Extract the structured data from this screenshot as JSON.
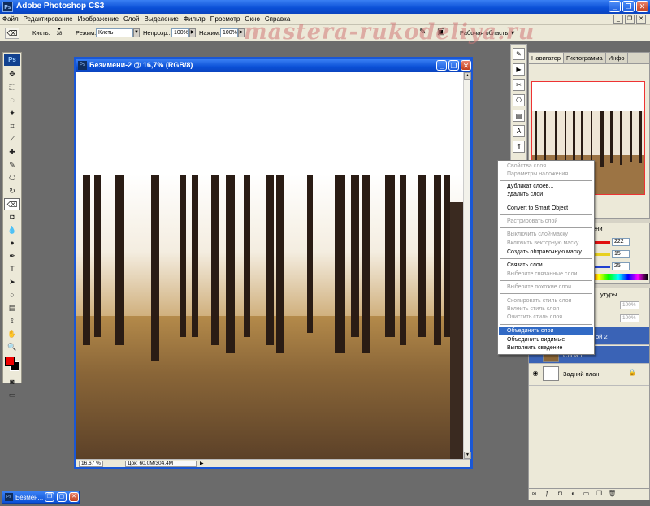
{
  "app": {
    "title": "Adobe Photoshop CS3",
    "logo": "Ps"
  },
  "menu": [
    "Файл",
    "Редактирование",
    "Изображение",
    "Слой",
    "Выделение",
    "Фильтр",
    "Просмотр",
    "Окно",
    "Справка"
  ],
  "options": {
    "brush_label": "Кисть:",
    "brush_size": "38",
    "mode_label": "Режим:",
    "mode_value": "Кисть",
    "opacity_label": "Непрозр.:",
    "opacity_value": "100%",
    "pressure_label": "Нажим:",
    "pressure_value": "100%",
    "workspace_label": "Рабочая область"
  },
  "watermark": "mastera-rukodeliya.ru",
  "document": {
    "title": "Безимени-2 @ 16,7% (RGB/8)",
    "zoom": "16,67 %",
    "info": "Док: 60,0M/304,4M"
  },
  "taskbar": {
    "item_label": "Безмен..."
  },
  "navigator": {
    "tabs": [
      "Навигатор",
      "Гистограмма",
      "Инфо"
    ]
  },
  "color_panel": {
    "tab_partial": "ени",
    "values": [
      "222",
      "15",
      "25"
    ],
    "colors": [
      "#e01010",
      "#e8d020",
      "#2040d0"
    ]
  },
  "layers_panel": {
    "tab_partial": "утуры",
    "opacity_box": "100%",
    "fill_box": "100%",
    "layers": [
      {
        "name": "ой 2",
        "selected": true
      },
      {
        "name": "Слой 1",
        "selected": true
      },
      {
        "name": "Задний план",
        "selected": false
      }
    ]
  },
  "context_menu": {
    "items": [
      {
        "label": "Свойства слоя...",
        "disabled": true
      },
      {
        "label": "Параметры наложения...",
        "disabled": true
      },
      {
        "label": "Дубликат слоев...",
        "disabled": false
      },
      {
        "label": "Удалить слои",
        "disabled": false
      },
      {
        "label": "Convert to Smart Object",
        "disabled": false
      },
      {
        "label": "Растрировать слой",
        "disabled": true
      },
      {
        "label": "Выключить слой-маску",
        "disabled": true
      },
      {
        "label": "Включить векторную маску",
        "disabled": true
      },
      {
        "label": "Создать обтравочную маску",
        "disabled": false
      },
      {
        "label": "Связать слои",
        "disabled": false
      },
      {
        "label": "Выберите связанные слои",
        "disabled": true
      },
      {
        "label": "Выберите похожие слои",
        "disabled": true
      },
      {
        "label": "Скопировать стиль слоя",
        "disabled": true
      },
      {
        "label": "Вклеить стиль слоя",
        "disabled": true
      },
      {
        "label": "Очистить стиль слоя",
        "disabled": true
      },
      {
        "label": "Объединить слои",
        "disabled": false,
        "highlighted": true
      },
      {
        "label": "Объединить видимые",
        "disabled": false
      },
      {
        "label": "Выполнить сведение",
        "disabled": false
      }
    ]
  },
  "colors": {
    "xp_blue": "#0a4fd6",
    "foreground": "#e00000",
    "background": "#000000",
    "menu_highlight": "#316ac5"
  }
}
